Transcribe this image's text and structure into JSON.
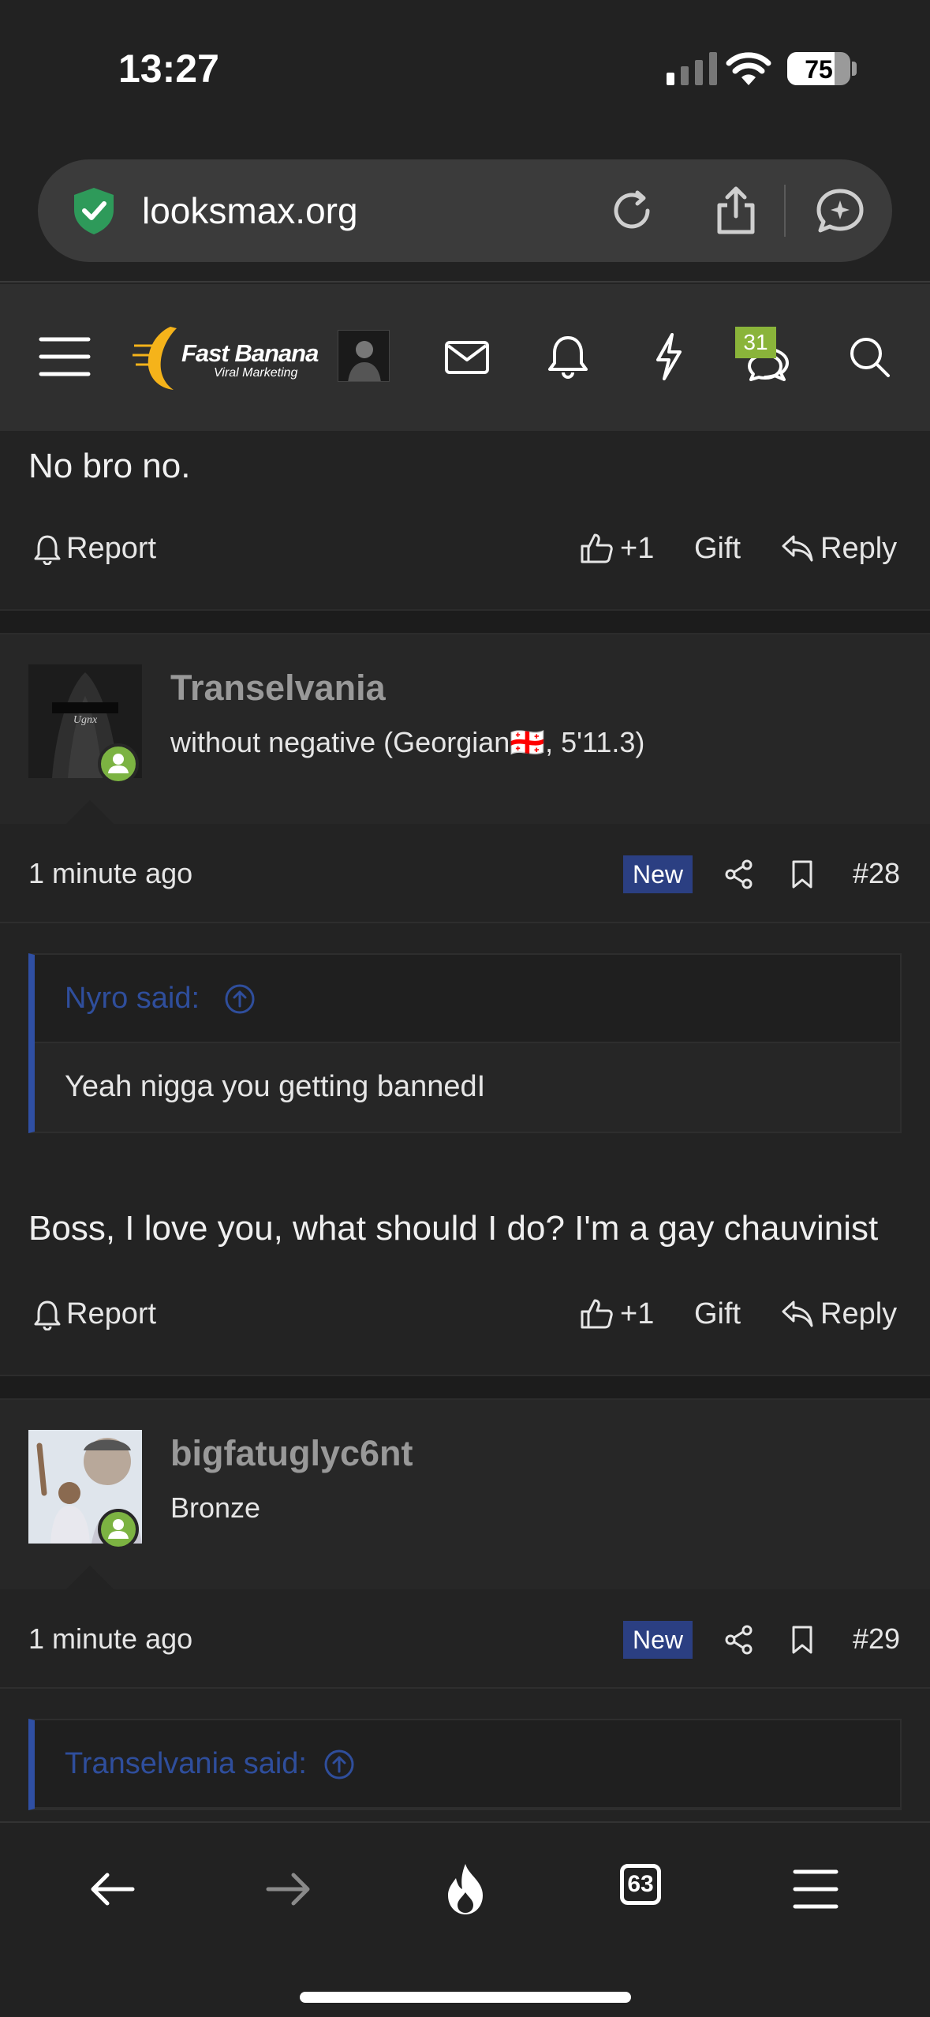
{
  "status_bar": {
    "time": "13:27",
    "battery": "75",
    "battery_level": 0.75
  },
  "browser": {
    "url": "looksmax.org"
  },
  "header": {
    "logo_title": "Fast Banana",
    "logo_subtitle": "Viral Marketing",
    "conversations_count": "31"
  },
  "prev_post": {
    "body": "No bro no.",
    "actions": {
      "report": "Report",
      "reaction": "+1",
      "gift": "Gift",
      "reply": "Reply"
    }
  },
  "posts": [
    {
      "username": "Transelvania",
      "user_title": "without negative (Georgian🇬🇪, 5'11.3)",
      "time": "1 minute ago",
      "new_label": "New",
      "post_number": "#28",
      "quote": {
        "author": "Nyro said:",
        "text": "Yeah nigga you getting bannedI"
      },
      "body": "Boss, I love you, what should I do? I'm a gay chauvinist",
      "actions": {
        "report": "Report",
        "reaction": "+1",
        "gift": "Gift",
        "reply": "Reply"
      }
    },
    {
      "username": "bigfatuglyc6nt",
      "user_title": "Bronze",
      "time": "1 minute ago",
      "new_label": "New",
      "post_number": "#29",
      "quote": {
        "author": "Transelvania said:"
      }
    }
  ],
  "bottom_bar": {
    "tabs_count": "63"
  },
  "colors": {
    "accent_blue": "#2b3f82",
    "online_green": "#7cb342",
    "badge_green": "#8ab43a"
  }
}
